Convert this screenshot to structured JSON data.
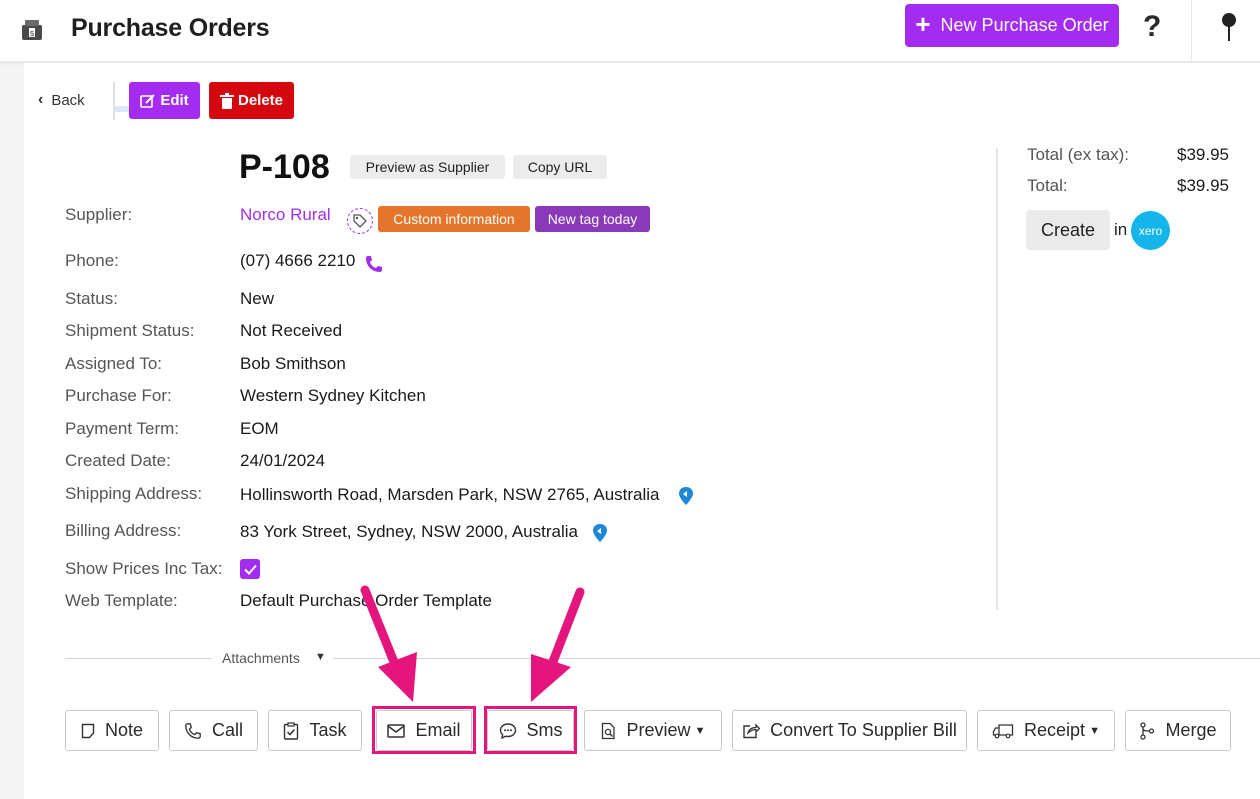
{
  "header": {
    "title": "Purchase Orders",
    "new_button": "New Purchase Order",
    "help_glyph": "?",
    "icons": [
      "cash-box-icon",
      "help-icon",
      "pin-icon"
    ]
  },
  "toolbar": {
    "back": "Back",
    "edit": "Edit",
    "delete": "Delete"
  },
  "order": {
    "number": "P-108",
    "preview_as_supplier": "Preview as Supplier",
    "copy_url": "Copy URL"
  },
  "fields": {
    "supplier": {
      "label": "Supplier:",
      "value": "Norco Rural"
    },
    "tags": [
      "Custom information",
      "New tag today"
    ],
    "phone": {
      "label": "Phone:",
      "value": "(07) 4666 2210"
    },
    "status": {
      "label": "Status:",
      "value": "New"
    },
    "shipment_status": {
      "label": "Shipment Status:",
      "value": "Not Received"
    },
    "assigned_to": {
      "label": "Assigned To:",
      "value": "Bob Smithson"
    },
    "purchase_for": {
      "label": "Purchase For:",
      "value": "Western Sydney Kitchen"
    },
    "payment_term": {
      "label": "Payment Term:",
      "value": "EOM"
    },
    "created_date": {
      "label": "Created Date:",
      "value": "24/01/2024"
    },
    "shipping_address": {
      "label": "Shipping Address:",
      "value": "Hollinsworth Road, Marsden Park, NSW 2765, Australia"
    },
    "billing_address": {
      "label": "Billing Address:",
      "value": "83 York Street, Sydney, NSW 2000, Australia"
    },
    "show_prices_inc_tax": {
      "label": "Show Prices Inc Tax:",
      "checked": true
    },
    "web_template": {
      "label": "Web Template:",
      "value": "Default Purchase Order Template"
    }
  },
  "totals": {
    "ex_tax_label": "Total (ex tax):",
    "ex_tax_value": "$39.95",
    "total_label": "Total:",
    "total_value": "$39.95",
    "create_button": "Create",
    "in_text": "in",
    "xero_logo": "xero"
  },
  "attachments": {
    "label": "Attachments"
  },
  "actions": {
    "note": "Note",
    "call": "Call",
    "task": "Task",
    "email": "Email",
    "sms": "Sms",
    "preview": "Preview",
    "convert": "Convert To Supplier Bill",
    "receipt": "Receipt",
    "merge": "Merge"
  },
  "colors": {
    "accent": "#a42cf0",
    "danger": "#d4060e",
    "tag_orange": "#e4752a",
    "tag_purple": "#8a3ab9",
    "annotation_pink": "#e4157d",
    "xero_blue": "#13b5ea"
  }
}
